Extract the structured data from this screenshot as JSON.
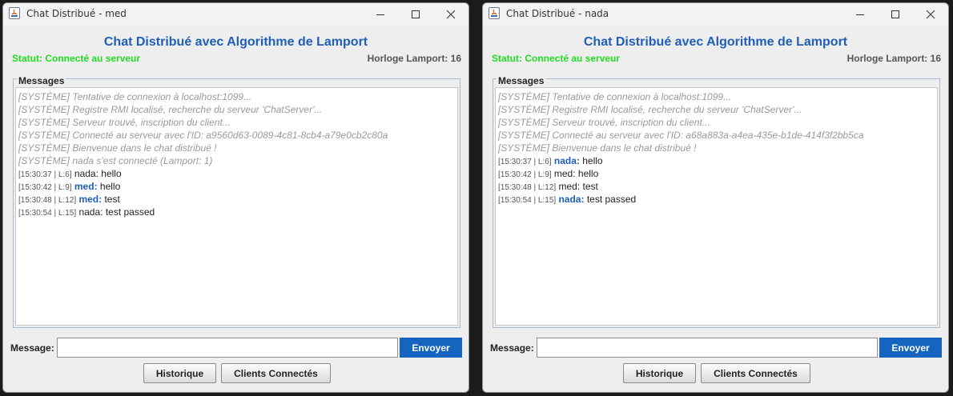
{
  "windows": [
    {
      "title": "Chat Distribué - med",
      "heading": "Chat Distribué avec Algorithme de Lamport",
      "status": "Statut: Connecté au serveur",
      "clock": "Horloge Lamport: 16",
      "messages_label": "Messages",
      "message_label": "Message:",
      "input_value": "",
      "send_label": "Envoyer",
      "history_label": "Historique",
      "clients_label": "Clients Connectés",
      "messages": [
        {
          "kind": "system",
          "text": "[SYSTÈME] Tentative de connexion à localhost:1099..."
        },
        {
          "kind": "system",
          "text": "[SYSTÈME] Registre RMI localisé, recherche du serveur 'ChatServer'..."
        },
        {
          "kind": "system",
          "text": "[SYSTÈME] Serveur trouvé, inscription du client..."
        },
        {
          "kind": "system",
          "text": "[SYSTÈME] Connecté au serveur avec l'ID: a9560d63-0089-4c81-8cb4-a79e0cb2c80a"
        },
        {
          "kind": "system",
          "text": "[SYSTÈME] Bienvenue dans le chat distribué !"
        },
        {
          "kind": "system",
          "text": "[SYSTÈME] nada s'est connecté (Lamport: 1)"
        },
        {
          "kind": "chat",
          "meta": "[15:30:37 | L:6]",
          "sender": "nada:",
          "self": false,
          "text": "hello"
        },
        {
          "kind": "chat",
          "meta": "[15:30:42 | L:9]",
          "sender": "med:",
          "self": true,
          "text": "hello"
        },
        {
          "kind": "chat",
          "meta": "[15:30:48 | L:12]",
          "sender": "med:",
          "self": true,
          "text": "test"
        },
        {
          "kind": "chat",
          "meta": "[15:30:54 | L:15]",
          "sender": "nada:",
          "self": false,
          "text": "test passed"
        }
      ]
    },
    {
      "title": "Chat Distribué - nada",
      "heading": "Chat Distribué avec Algorithme de Lamport",
      "status": "Statut: Connecté au serveur",
      "clock": "Horloge Lamport: 16",
      "messages_label": "Messages",
      "message_label": "Message:",
      "input_value": "",
      "send_label": "Envoyer",
      "history_label": "Historique",
      "clients_label": "Clients Connectés",
      "messages": [
        {
          "kind": "system",
          "text": "[SYSTÈME] Tentative de connexion à localhost:1099..."
        },
        {
          "kind": "system",
          "text": "[SYSTÈME] Registre RMI localisé, recherche du serveur 'ChatServer'..."
        },
        {
          "kind": "system",
          "text": "[SYSTÈME] Serveur trouvé, inscription du client..."
        },
        {
          "kind": "system",
          "text": "[SYSTÈME] Connecté au serveur avec l'ID: a68a883a-a4ea-435e-b1de-414f3f2bb5ca"
        },
        {
          "kind": "system",
          "text": "[SYSTÈME] Bienvenue dans le chat distribué !"
        },
        {
          "kind": "chat",
          "meta": "[15:30:37 | L:6]",
          "sender": "nada:",
          "self": true,
          "text": "hello"
        },
        {
          "kind": "chat",
          "meta": "[15:30:42 | L:9]",
          "sender": "med:",
          "self": false,
          "text": "hello"
        },
        {
          "kind": "chat",
          "meta": "[15:30:48 | L:12]",
          "sender": "med:",
          "self": false,
          "text": "test"
        },
        {
          "kind": "chat",
          "meta": "[15:30:54 | L:15]",
          "sender": "nada:",
          "self": true,
          "text": "test passed"
        }
      ]
    }
  ],
  "colors": {
    "heading": "#1f5fb8",
    "status": "#22dd22",
    "self_sender": "#1f5fb8",
    "send_button": "#1565c0",
    "system_text": "#9a9a9a"
  },
  "icons": {
    "app": "java-app-icon",
    "minimize": "minimize-icon",
    "maximize": "maximize-icon",
    "close": "close-icon"
  }
}
